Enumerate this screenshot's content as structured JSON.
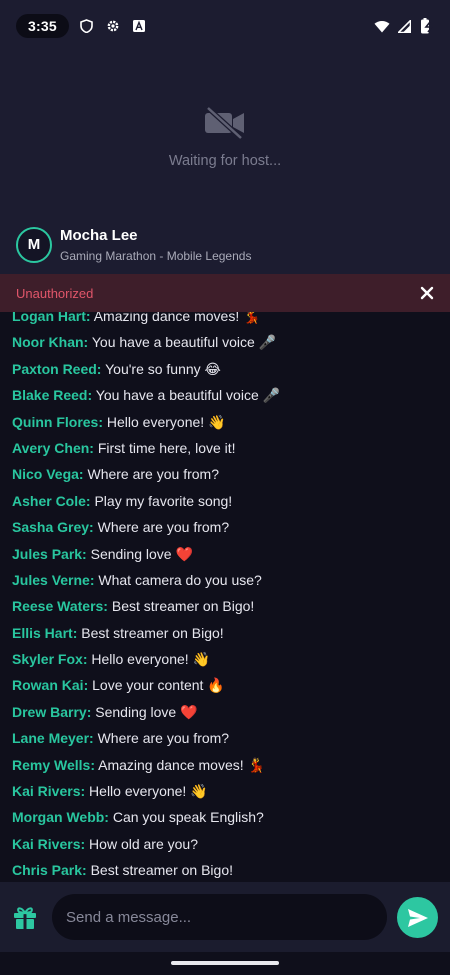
{
  "status_bar": {
    "time": "3:35",
    "icons": [
      "shield-icon",
      "gear-icon",
      "font-icon",
      "wifi-icon",
      "signal-icon",
      "battery-icon"
    ]
  },
  "video": {
    "icon": "video-off-icon",
    "waiting_text": "Waiting for host..."
  },
  "host": {
    "avatar_initial": "M",
    "name": "Mocha Lee",
    "stream_title": "Gaming Marathon - Mobile Legends"
  },
  "error_banner": {
    "message": "Unauthorized",
    "close_icon": "close-icon"
  },
  "chat": {
    "messages": [
      {
        "user": "Logan Hart:",
        "text": "Amazing dance moves! 💃"
      },
      {
        "user": "Noor Khan:",
        "text": "You have a beautiful voice 🎤"
      },
      {
        "user": "Paxton Reed:",
        "text": "You're so funny 😂"
      },
      {
        "user": "Blake Reed:",
        "text": "You have a beautiful voice 🎤"
      },
      {
        "user": "Quinn Flores:",
        "text": "Hello everyone! 👋"
      },
      {
        "user": "Avery Chen:",
        "text": "First time here, love it!"
      },
      {
        "user": "Nico Vega:",
        "text": "Where are you from?"
      },
      {
        "user": "Asher Cole:",
        "text": "Play my favorite song!"
      },
      {
        "user": "Sasha Grey:",
        "text": "Where are you from?"
      },
      {
        "user": "Jules Park:",
        "text": "Sending love ❤️"
      },
      {
        "user": "Jules Verne:",
        "text": "What camera do you use?"
      },
      {
        "user": "Reese Waters:",
        "text": "Best streamer on Bigo!"
      },
      {
        "user": "Ellis Hart:",
        "text": "Best streamer on Bigo!"
      },
      {
        "user": "Skyler Fox:",
        "text": "Hello everyone! 👋"
      },
      {
        "user": "Rowan Kai:",
        "text": "Love your content 🔥"
      },
      {
        "user": "Drew Barry:",
        "text": "Sending love ❤️"
      },
      {
        "user": "Lane Meyer:",
        "text": "Where are you from?"
      },
      {
        "user": "Remy Wells:",
        "text": "Amazing dance moves! 💃"
      },
      {
        "user": "Kai Rivers:",
        "text": "Hello everyone! 👋"
      },
      {
        "user": "Morgan Webb:",
        "text": "Can you speak English?"
      },
      {
        "user": "Kai Rivers:",
        "text": "How old are you?"
      },
      {
        "user": "Chris Park:",
        "text": "Best streamer on Bigo!"
      }
    ]
  },
  "composer": {
    "placeholder": "Send a message...",
    "gift_icon": "gift-icon",
    "send_icon": "send-icon"
  },
  "colors": {
    "accent": "#2dc7a1",
    "username": "#29c69f",
    "error_text": "#e0566a",
    "error_bg": "#3e1e2a",
    "video_bg": "#1c1c30",
    "chat_bg": "#0f0f1b"
  }
}
